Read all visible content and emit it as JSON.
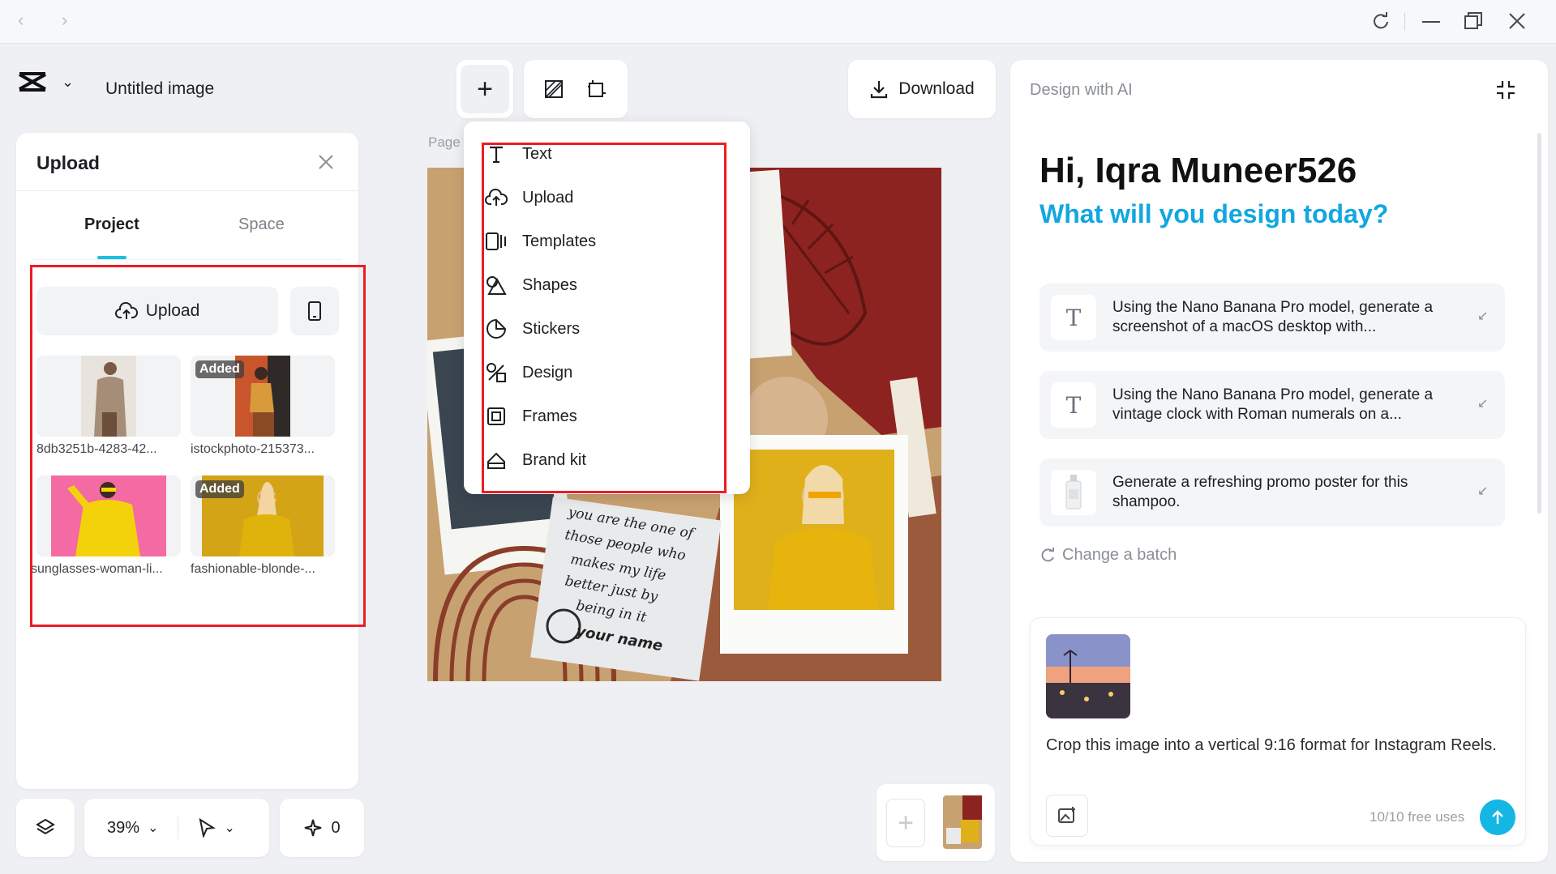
{
  "browser": {
    "back": "‹",
    "forward": "›"
  },
  "header": {
    "doc_title": "Untitled image"
  },
  "upload_panel": {
    "title": "Upload",
    "tabs": [
      {
        "label": "Project"
      },
      {
        "label": "Space"
      }
    ],
    "upload_label": "Upload",
    "files": [
      {
        "name": "8db3251b-4283-42...",
        "added": ""
      },
      {
        "name": "istockphoto-215373...",
        "added": "Added"
      },
      {
        "name": "sunglasses-woman-li...",
        "added": ""
      },
      {
        "name": "fashionable-blonde-...",
        "added": "Added"
      }
    ]
  },
  "bottom_bar": {
    "zoom": "39%",
    "ai_credits": "0"
  },
  "toolbar": {
    "download_label": "Download"
  },
  "canvas": {
    "page_label": "Page",
    "note_lines": [
      "you are the one of",
      "those people who",
      "makes my life",
      "better just by",
      "being in it"
    ],
    "note_signature": "your name"
  },
  "add_menu": {
    "items": [
      {
        "label": "Text",
        "icon": "text-icon"
      },
      {
        "label": "Upload",
        "icon": "cloud-upload-icon"
      },
      {
        "label": "Templates",
        "icon": "templates-icon"
      },
      {
        "label": "Shapes",
        "icon": "shapes-icon"
      },
      {
        "label": "Stickers",
        "icon": "sticker-icon"
      },
      {
        "label": "Design",
        "icon": "design-icon"
      },
      {
        "label": "Frames",
        "icon": "frame-icon"
      },
      {
        "label": "Brand kit",
        "icon": "brand-kit-icon"
      }
    ]
  },
  "ai_panel": {
    "title": "Design with AI",
    "greeting": "Hi, Iqra Muneer526",
    "subtitle": "What will you design today?",
    "suggestions": [
      {
        "text": "Using the Nano Banana Pro model, generate a screenshot of a macOS desktop with...",
        "icon": "T"
      },
      {
        "text": "Using the Nano Banana Pro model, generate a vintage clock with Roman numerals on a...",
        "icon": "T"
      },
      {
        "text": "Generate a refreshing promo poster for this shampoo.",
        "icon": ""
      }
    ],
    "change_batch": "Change a batch",
    "composer": {
      "prompt": "Crop this image into a vertical 9:16 format for Instagram Reels.",
      "uses": "10/10 free uses"
    }
  },
  "colors": {
    "accent": "#11a7e0",
    "highlight": "#ec1c24",
    "send": "#14b7e3"
  }
}
